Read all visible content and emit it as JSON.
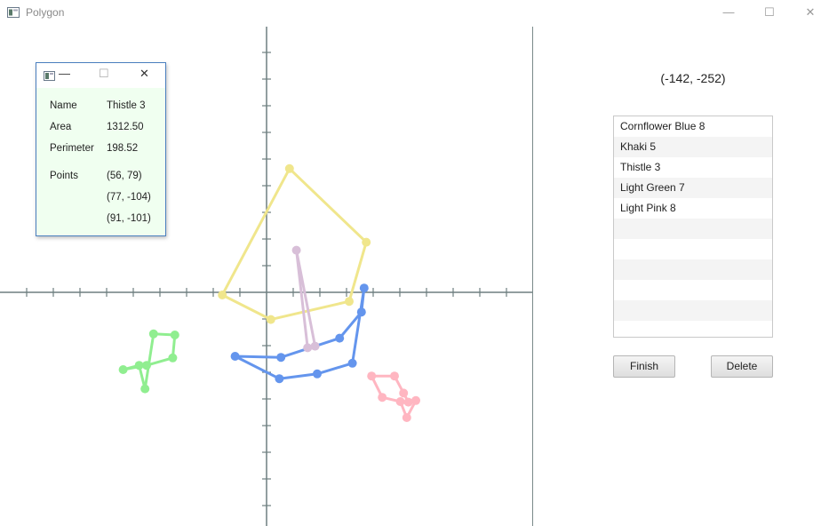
{
  "window": {
    "title": "Polygon",
    "icon": "app-window-icon",
    "controls": {
      "minimize": "—",
      "maximize": "☐",
      "close": "✕"
    }
  },
  "coordinate_readout": "(-142, -252)",
  "polygon_list": [
    "Cornflower Blue 8",
    "Khaki 5",
    "Thistle 3",
    "Light Green 7",
    "Light Pink 8"
  ],
  "buttons": {
    "finish": "Finish",
    "delete": "Delete"
  },
  "info_panel": {
    "controls": {
      "minimize": "—",
      "maximize": "☐",
      "close": "✕"
    },
    "name_label": "Name",
    "name_value": "Thistle 3",
    "area_label": "Area",
    "area_value": "1312.50",
    "perimeter_label": "Perimeter",
    "perimeter_value": "198.52",
    "points_label": "Points",
    "points": [
      "(56, 79)",
      "(77, -104)",
      "(91, -101)"
    ]
  },
  "polygons": [
    {
      "name": "Cornflower Blue 8",
      "color": "#6495ED",
      "points": [
        [
          -59,
          -120
        ],
        [
          27,
          -122
        ],
        [
          137,
          -86
        ],
        [
          178,
          -37
        ],
        [
          183,
          8
        ],
        [
          161,
          -133
        ],
        [
          95,
          -153
        ],
        [
          24,
          -162
        ]
      ]
    },
    {
      "name": "Khaki 5",
      "color": "#F0E68C",
      "points": [
        [
          -83,
          -5
        ],
        [
          43,
          232
        ],
        [
          187,
          94
        ],
        [
          155,
          -17
        ],
        [
          8,
          -51
        ]
      ]
    },
    {
      "name": "Thistle 3",
      "color": "#D8BFD8",
      "points": [
        [
          56,
          79
        ],
        [
          77,
          -104
        ],
        [
          91,
          -101
        ]
      ]
    },
    {
      "name": "Light Green 7",
      "color": "#90EE90",
      "points": [
        [
          -212,
          -78
        ],
        [
          -172,
          -80
        ],
        [
          -176,
          -123
        ],
        [
          -225,
          -137
        ],
        [
          -269,
          -145
        ],
        [
          -239,
          -137
        ],
        [
          -228,
          -181
        ]
      ]
    },
    {
      "name": "Light Pink 8",
      "color": "#FFB6C1",
      "points": [
        [
          197,
          -157
        ],
        [
          240,
          -157
        ],
        [
          257,
          -189
        ],
        [
          266,
          -206
        ],
        [
          280,
          -203
        ],
        [
          263,
          -235
        ],
        [
          251,
          -205
        ],
        [
          217,
          -197
        ]
      ]
    }
  ]
}
